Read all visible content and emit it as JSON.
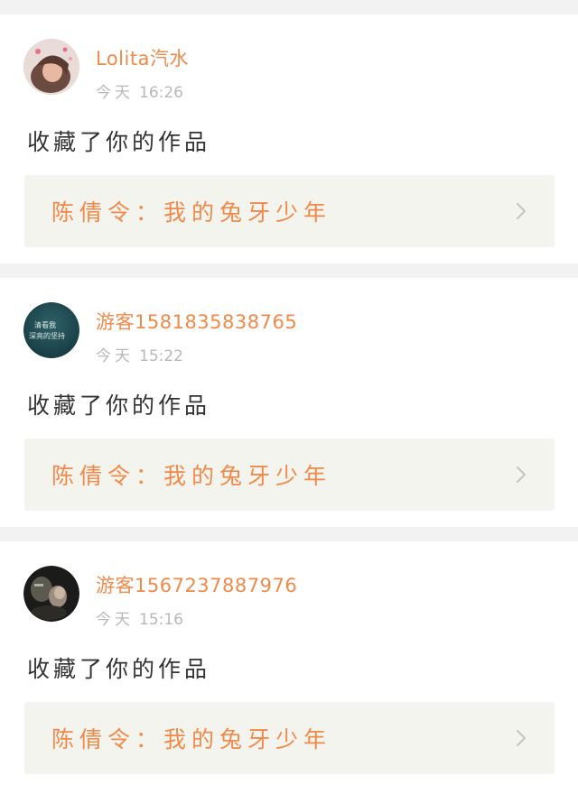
{
  "colors": {
    "accent": "#f08a4b",
    "text": "#333333",
    "muted": "#b8b8b8",
    "card_bg": "#ffffff",
    "work_box_bg": "#f4f4ee",
    "page_bg": "#f2f2f2"
  },
  "notifications": [
    {
      "username": "Lolita汽水",
      "day": "今天",
      "time": "16:26",
      "action": "收藏了你的作品",
      "work": "陈倩令：我的兔牙少年",
      "avatar": "avatar-lolita"
    },
    {
      "username": "游客1581835838765",
      "day": "今天",
      "time": "15:22",
      "action": "收藏了你的作品",
      "work": "陈倩令：我的兔牙少年",
      "avatar": "avatar-text-image",
      "avatar_text": [
        "清看我",
        "深亮的坚持"
      ]
    },
    {
      "username": "游客1567237887976",
      "day": "今天",
      "time": "15:16",
      "action": "收藏了你的作品",
      "work": "陈倩令：我的兔牙少年",
      "avatar": "avatar-photo-dark"
    }
  ]
}
